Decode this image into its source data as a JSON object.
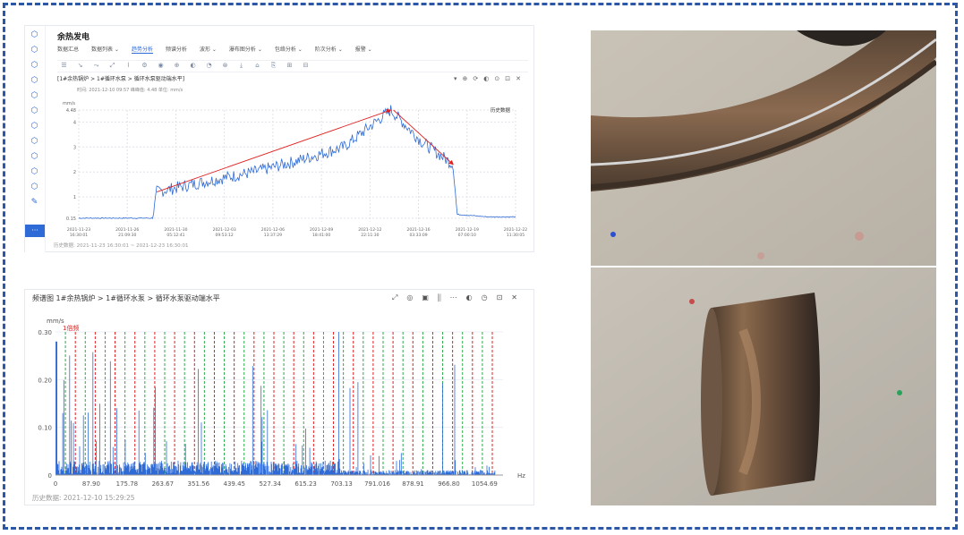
{
  "app": {
    "title": "余热发电",
    "menu": [
      {
        "label": "数据汇总",
        "active": false
      },
      {
        "label": "数据列表 ⌄",
        "active": false
      },
      {
        "label": "趋势分析",
        "active": true
      },
      {
        "label": "频谱分析",
        "active": false
      },
      {
        "label": "波形 ⌄",
        "active": false
      },
      {
        "label": "瀑布图分析 ⌄",
        "active": false
      },
      {
        "label": "包络分析 ⌄",
        "active": false
      },
      {
        "label": "阶次分析 ⌄",
        "active": false
      },
      {
        "label": "报警 ⌄",
        "active": false
      }
    ],
    "chart_header": "[1#余热锅炉 > 1#循环水泵 > 循环水泵驱动端水平]",
    "chart_subheader": "时间: 2021-12-10 09:57    峰峰值: 4.48    单位: mm/s",
    "right_label": "历史数据",
    "footer": "历史数据: 2021-11-23 16:30:01 ~ 2021-12-23 16:30:01"
  },
  "spectrum": {
    "title": "频谱图   1#余热锅炉 > 1#循环水泵 > 循环水泵驱动端水平",
    "footer": "历史数据: 2021-12-10 15:29:25",
    "marker_label": "1倍频"
  },
  "chart_data": [
    {
      "type": "line",
      "title": "",
      "ylabel": "mm/s",
      "ylim": [
        0,
        4.48
      ],
      "yticks": [
        "4.48",
        "4",
        "3",
        "2",
        "1",
        "0.15"
      ],
      "xlabel": "",
      "x": [
        "2021-11-23 16:30:01",
        "2021-11-26 21:09:30",
        "2021-11-30 05:12:41",
        "2021-12-03 09:53:12",
        "2021-12-06 13:37:29",
        "2021-12-09 18:41:00",
        "2021-12-12 22:11:30",
        "2021-12-16 03:33:09",
        "2021-12-19 07:00:10",
        "2021-12-22 11:30:05"
      ],
      "xticks": [
        "2021-11-23 16:30:01",
        "2021-11-26 21:09:30",
        "2021-11-30 05:12:41",
        "2021-12-03 09:53:12",
        "2021-12-06 13:37:29",
        "2021-12-09 18:41:00",
        "2021-12-12 22:11:30",
        "2021-12-16 03:33:09",
        "2021-12-19 07:00:10",
        "2021-12-22 11:30:05"
      ],
      "series": [
        {
          "values": [
            0.15,
            0.15,
            0.15,
            1.2,
            1.6,
            2.0,
            2.4,
            3.0,
            4.48,
            3.2,
            2.3,
            0.3,
            0.2,
            0.2
          ],
          "t": [
            0,
            0.08,
            0.19,
            0.2,
            0.32,
            0.45,
            0.55,
            0.68,
            0.8,
            0.88,
            0.96,
            0.97,
            1.05,
            1.12
          ]
        }
      ],
      "annotations": [
        "rising trend arrow",
        "falling trend arrow"
      ],
      "grid": true
    },
    {
      "type": "bar",
      "title": "",
      "ylabel": "mm/s",
      "xlabel": "Hz",
      "ylim": [
        0,
        0.3
      ],
      "yticks": [
        "0.30",
        "0.20",
        "0.10",
        "0"
      ],
      "xticks": [
        "0",
        "87.90",
        "175.78",
        "263.67",
        "351.56",
        "439.45",
        "527.34",
        "615.23",
        "703.13",
        "791.016",
        "878.91",
        "966.80",
        "1054.69"
      ],
      "xlim": [
        0,
        1100
      ],
      "marker_spacing_hz": 24.4,
      "marker_label": "1倍频",
      "grid": false
    }
  ],
  "icons": {
    "sidebar": [
      "cube-icon",
      "cube-icon",
      "cube-icon",
      "cube-icon",
      "cube-icon",
      "cube-icon",
      "cube-icon",
      "cube-icon",
      "cube-icon",
      "cube-icon",
      "cube-icon",
      "wrench-icon",
      "menu-icon"
    ]
  },
  "colors": {
    "accent": "#2f6bd6",
    "border": "#2b57a6",
    "trend_line": "#2f6bd6",
    "arrow": "#e02020",
    "spectrum_bar": "#2f6bd6",
    "marker_red": "#e02020",
    "marker_green": "#2ea84a"
  }
}
